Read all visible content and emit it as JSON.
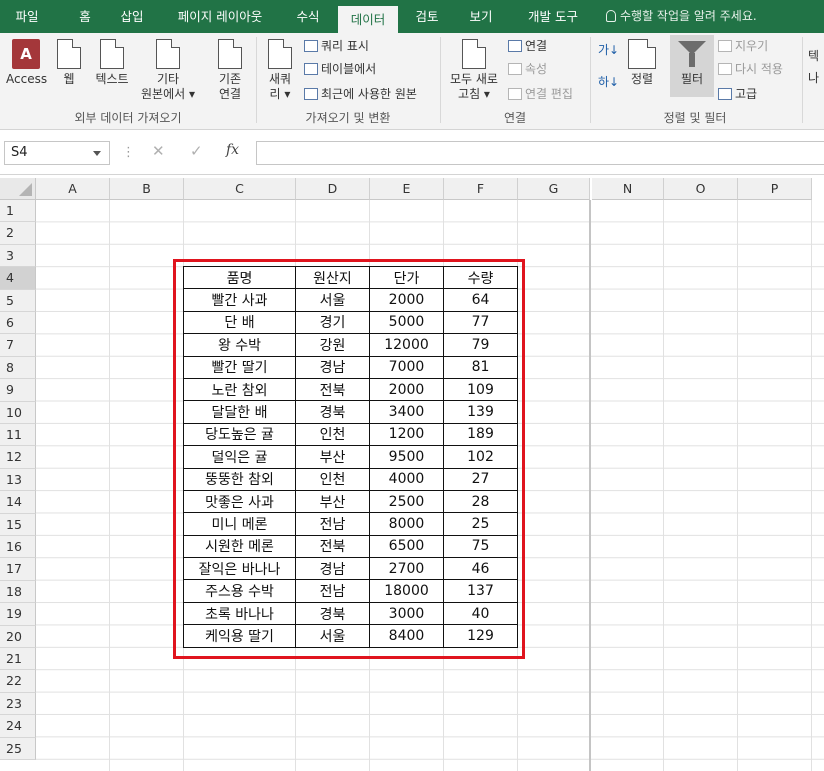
{
  "ribbon_tabs": [
    "파일",
    "홈",
    "삽입",
    "페이지 레이아웃",
    "수식",
    "데이터",
    "검토",
    "보기",
    "개발 도구"
  ],
  "active_tab": "데이터",
  "tell_me": "수행할 작업을 알려 주세요.",
  "groups": {
    "external": {
      "label": "외부 데이터 가져오기",
      "access": "Access",
      "web": "웹",
      "text": "텍스트",
      "other_l1": "기타",
      "other_l2": "원본에서 ▾",
      "existing_l1": "기존",
      "existing_l2": "연결"
    },
    "get_transform": {
      "label": "가져오기 및 변환",
      "new_query_l1": "새쿼",
      "new_query_l2": "리 ▾",
      "show_queries": "쿼리 표시",
      "from_table": "테이블에서",
      "recent_sources": "최근에 사용한 원본"
    },
    "connections": {
      "label": "연결",
      "refresh_l1": "모두 새로",
      "refresh_l2": "고침 ▾",
      "connections": "연결",
      "properties": "속성",
      "edit_links": "연결 편집"
    },
    "sort_filter": {
      "label": "정렬 및 필터",
      "sort": "정렬",
      "filter": "필터",
      "clear": "지우기",
      "reapply": "다시 적용",
      "advanced": "고급",
      "az": "가↓",
      "za": "하↓"
    },
    "cut_off_label": "텍\n나"
  },
  "formula_bar": {
    "name_box": "S4",
    "fx": "fx",
    "cancel": "✕",
    "enter": "✓",
    "content": ""
  },
  "columns": [
    "A",
    "B",
    "C",
    "D",
    "E",
    "F",
    "G",
    "N",
    "O",
    "P"
  ],
  "rows": [
    "1",
    "2",
    "3",
    "4",
    "5",
    "6",
    "7",
    "8",
    "9",
    "10",
    "11",
    "12",
    "13",
    "14",
    "15",
    "16",
    "17",
    "18",
    "19",
    "20",
    "21",
    "22",
    "23",
    "24",
    "25"
  ],
  "table": {
    "headers": [
      "품명",
      "원산지",
      "단가",
      "수량"
    ],
    "rows": [
      [
        "빨간 사과",
        "서울",
        "2000",
        "64"
      ],
      [
        "단 배",
        "경기",
        "5000",
        "77"
      ],
      [
        "왕 수박",
        "강원",
        "12000",
        "79"
      ],
      [
        "빨간 딸기",
        "경남",
        "7000",
        "81"
      ],
      [
        "노란 참외",
        "전북",
        "2000",
        "109"
      ],
      [
        "달달한 배",
        "경북",
        "3400",
        "139"
      ],
      [
        "당도높은 귤",
        "인천",
        "1200",
        "189"
      ],
      [
        "덜익은 귤",
        "부산",
        "9500",
        "102"
      ],
      [
        "뚱뚱한 참외",
        "인천",
        "4000",
        "27"
      ],
      [
        "맛좋은 사과",
        "부산",
        "2500",
        "28"
      ],
      [
        "미니 메론",
        "전남",
        "8000",
        "25"
      ],
      [
        "시원한 메론",
        "전북",
        "6500",
        "75"
      ],
      [
        "잘익은 바나나",
        "경남",
        "2700",
        "46"
      ],
      [
        "주스용 수박",
        "전남",
        "18000",
        "137"
      ],
      [
        "초록 바나나",
        "경북",
        "3000",
        "40"
      ],
      [
        "케익용 딸기",
        "서울",
        "8400",
        "129"
      ]
    ]
  },
  "colors": {
    "excel_green": "#217346",
    "highlight_border": "#e0141e"
  }
}
